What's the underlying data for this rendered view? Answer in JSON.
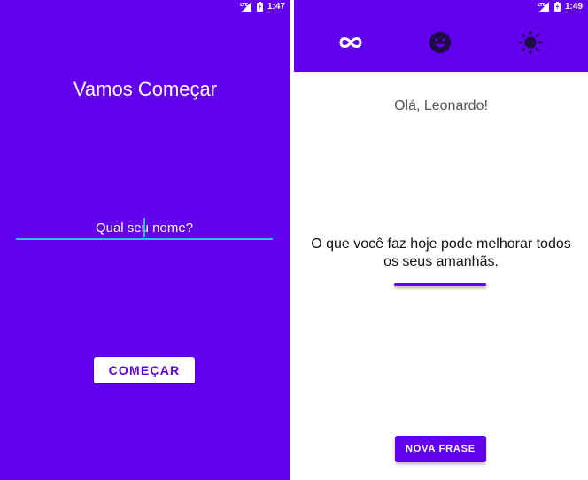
{
  "colors": {
    "primary": "#6200ee",
    "accent": "#26c6da",
    "white": "#ffffff"
  },
  "left_screen": {
    "status": {
      "network": "LTE",
      "time": "1:47"
    },
    "title": "Vamos Começar",
    "name_input": {
      "value": "Qual seu nome?"
    },
    "start_button": "COMEÇAR"
  },
  "right_screen": {
    "status": {
      "network": "LTE",
      "time": "1:49"
    },
    "tabs": [
      {
        "icon": "infinity-icon"
      },
      {
        "icon": "smiley-icon"
      },
      {
        "icon": "sun-icon"
      }
    ],
    "greeting": "Olá, Leonardo!",
    "quote": "O que você faz hoje pode melhorar todos os seus amanhãs.",
    "new_quote_button": "NOVA FRASE"
  }
}
